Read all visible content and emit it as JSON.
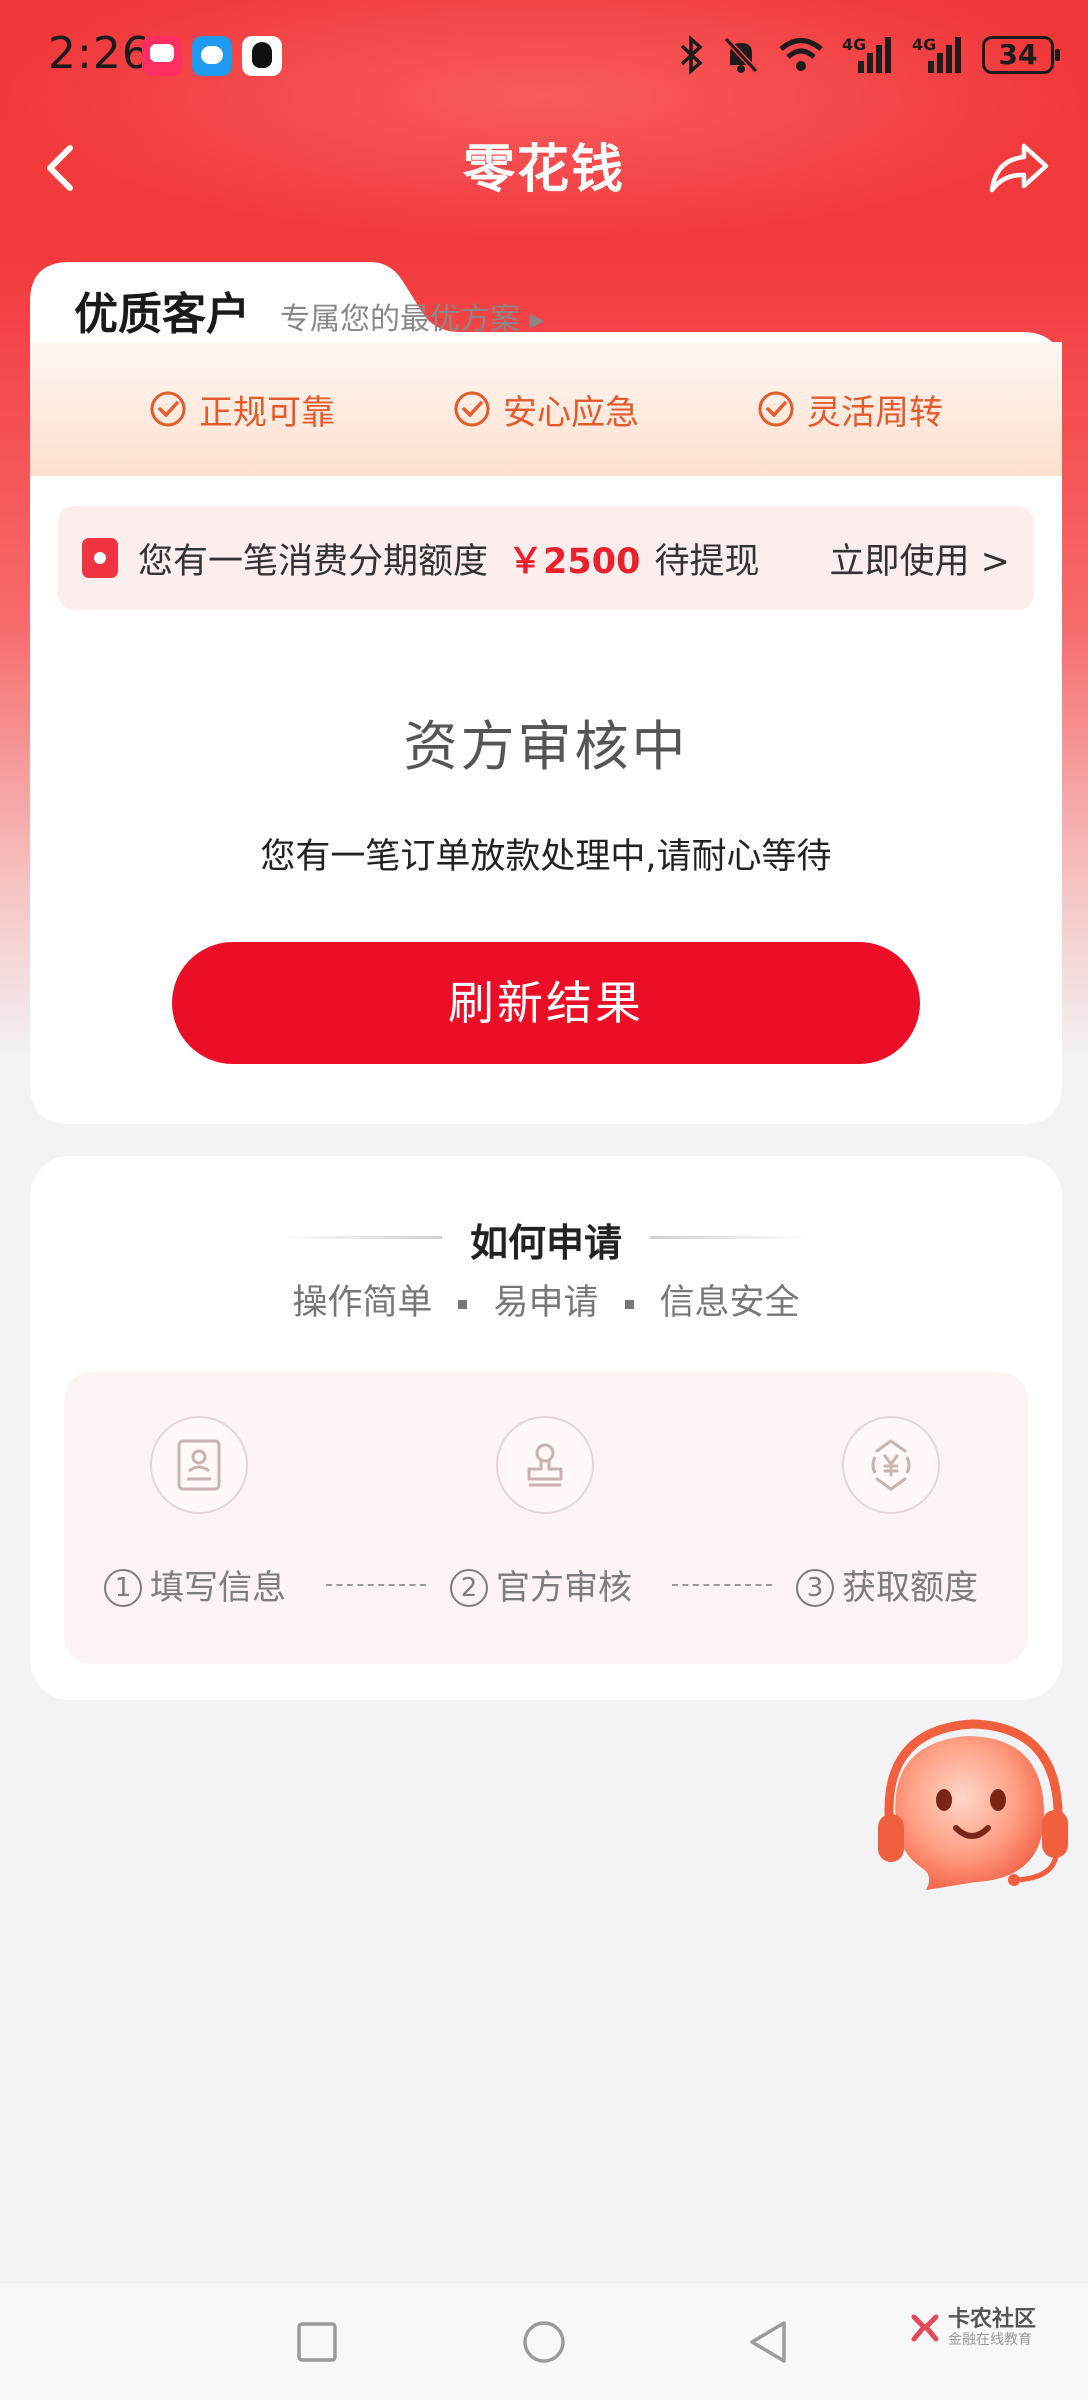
{
  "status_bar": {
    "time": "2:26",
    "network": "4G",
    "network2": "4G",
    "battery": "34",
    "icons": [
      "bluetooth-icon",
      "mute-icon",
      "wifi-icon",
      "signal-icon",
      "signal-icon",
      "battery-icon"
    ]
  },
  "nav": {
    "title": "零花钱",
    "back_icon": "chevron-left-icon",
    "share_icon": "share-icon"
  },
  "vip": {
    "title": "优质客户",
    "subtitle": "专属您的最优方案 ▸",
    "features": [
      "正规可靠",
      "安心应急",
      "灵活周转"
    ]
  },
  "promo": {
    "text": "您有一笔消费分期额度",
    "amount": "￥2500",
    "suffix": "待提现",
    "link": "立即使用 >"
  },
  "review": {
    "title": "资方审核中",
    "desc": "您有一笔订单放款处理中,请耐心等待",
    "button": "刷新结果"
  },
  "how": {
    "title": "如何申请",
    "tags": [
      "操作简单",
      "易申请",
      "信息安全"
    ],
    "steps": [
      {
        "num": "1",
        "label": "填写信息",
        "icon": "form-icon"
      },
      {
        "num": "2",
        "label": "官方审核",
        "icon": "stamp-icon"
      },
      {
        "num": "3",
        "label": "获取额度",
        "icon": "yuan-icon"
      }
    ]
  },
  "service": {
    "icon": "customer-service-mascot-icon"
  },
  "watermark": {
    "title": "卡农社区",
    "sub": "金融在线教育"
  },
  "colors": {
    "primary": "#ec0d26",
    "accent": "#e25a2d",
    "bg": "#f3f2f4"
  }
}
